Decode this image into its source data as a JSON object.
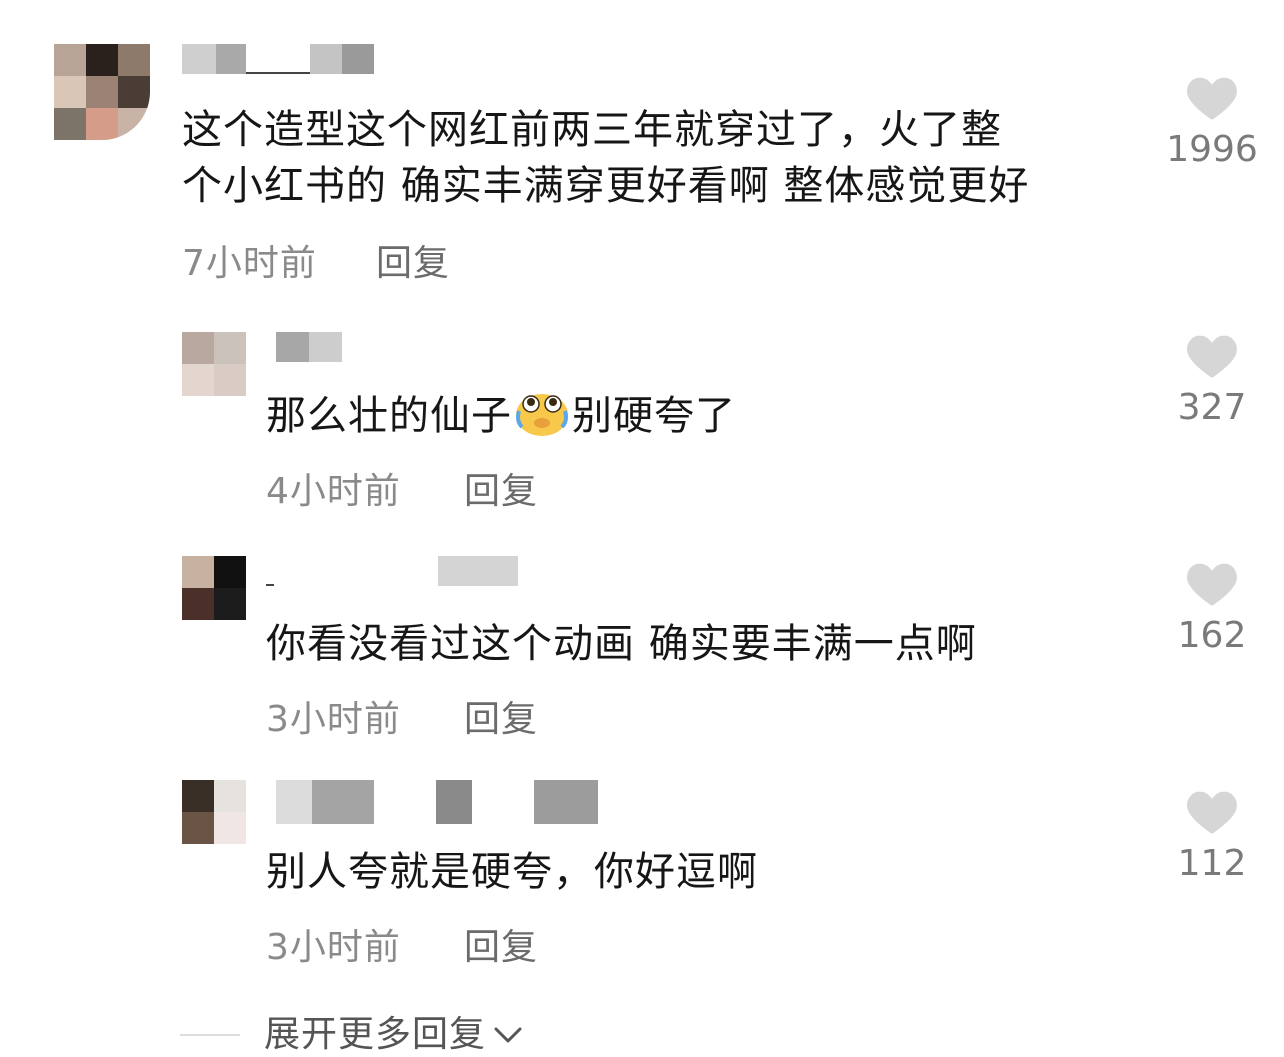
{
  "comments": [
    {
      "content": "这个造型这个网红前两三年就穿过了，火了整",
      "content_line2": "个小红书的 确实丰满穿更好看啊 整体感觉更好",
      "time": "7小时前",
      "reply_label": "回复",
      "likes": "1996"
    },
    {
      "content_before": "那么壮的仙子",
      "emoji": "crying-laughing-emoji",
      "content_after": "别硬夸了",
      "time": "4小时前",
      "reply_label": "回复",
      "likes": "327"
    },
    {
      "content": "你看没看过这个动画 确实要丰满一点啊",
      "time": "3小时前",
      "reply_label": "回复",
      "likes": "162"
    },
    {
      "content": "别人夸就是硬夸，你好逗啊",
      "time": "3小时前",
      "reply_label": "回复",
      "likes": "112"
    }
  ],
  "expand_more": "展开更多回复",
  "colors": {
    "text": "#161616",
    "meta": "#8a8a8a",
    "heart": "#d6d6d6"
  }
}
